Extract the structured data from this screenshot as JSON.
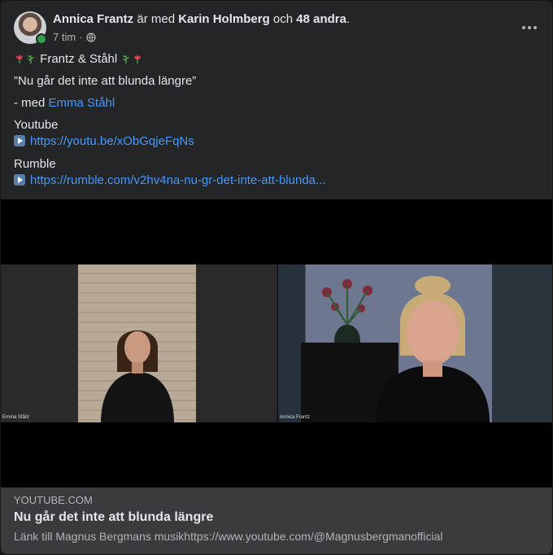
{
  "post": {
    "author": "Annica Frantz",
    "with_text": "är med",
    "tagged": "Karin Holmberg",
    "and_text": "och",
    "others": "48 andra",
    "period": ".",
    "time": "7 tim",
    "dot": "·",
    "privacy_icon": "globe-icon",
    "more_icon": "more-options-icon"
  },
  "content": {
    "title_text": "Frantz & Ståhl",
    "quote": "”Nu går det inte att blunda längre”",
    "with_prefix": "- med",
    "with_name": "Emma Ståhl",
    "youtube_label": "Youtube",
    "youtube_url": "https://youtu.be/xObGqjeFqNs",
    "rumble_label": "Rumble",
    "rumble_url": "https://rumble.com/v2hv4na-nu-gr-det-inte-att-blunda..."
  },
  "video": {
    "left_label": "Emma Ståhl",
    "right_label": "Annica Frantz"
  },
  "preview": {
    "domain": "YOUTUBE.COM",
    "title": "Nu går det inte att blunda längre",
    "description": "Länk till Magnus Bergmans musikhttps://www.youtube.com/@Magnusbergmanofficial"
  },
  "colors": {
    "card_bg": "#242526",
    "link": "#4599ff",
    "online": "#31a24c"
  }
}
